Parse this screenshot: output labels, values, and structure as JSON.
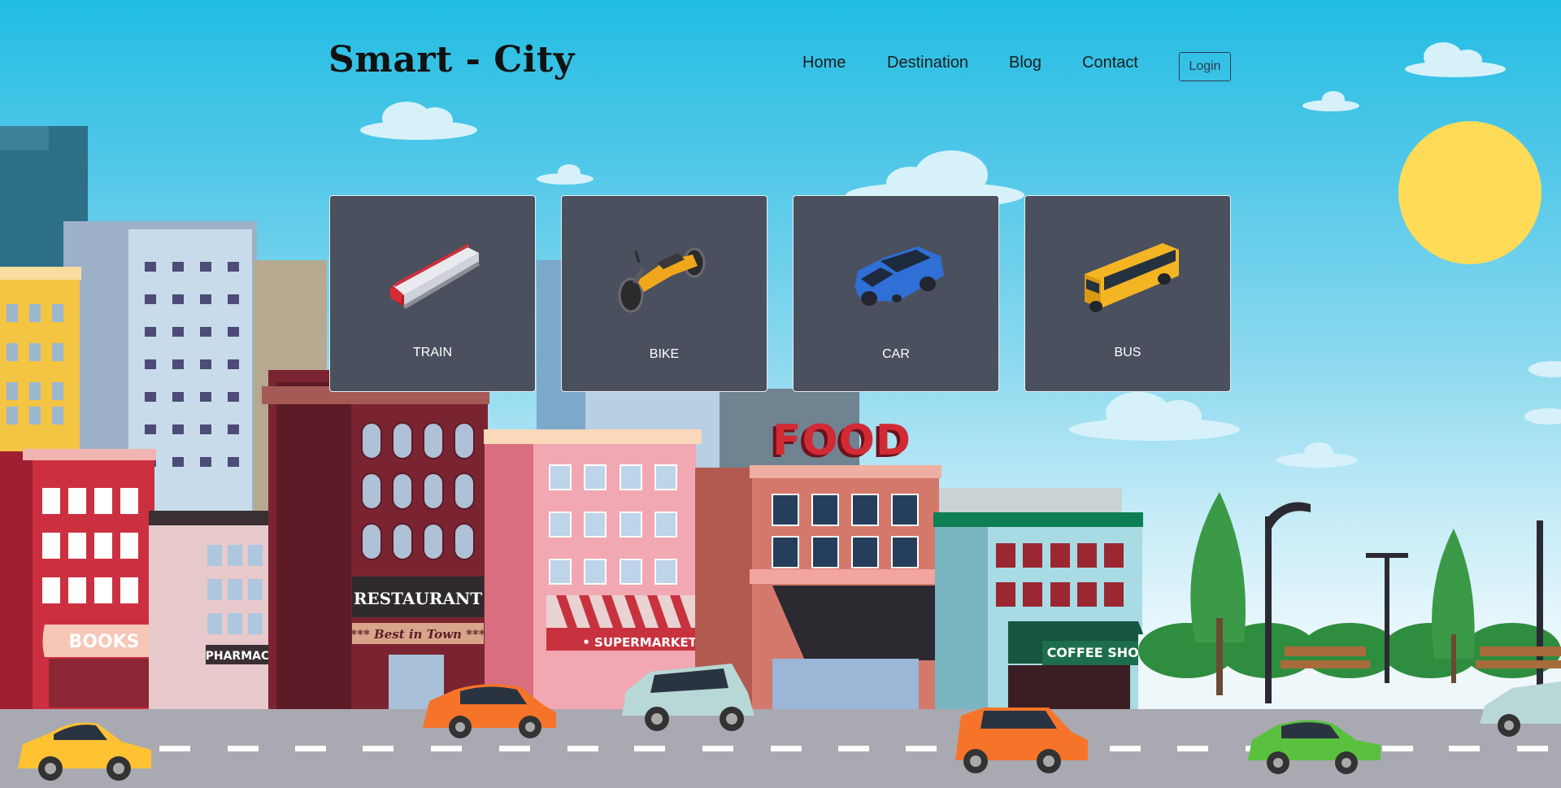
{
  "header": {
    "brand": "Smart - City",
    "nav": [
      "Home",
      "Destination",
      "Blog",
      "Contact"
    ],
    "login_label": "Login"
  },
  "cards": [
    {
      "label": "TRAIN",
      "icon": "train-icon"
    },
    {
      "label": "BIKE",
      "icon": "motorbike-icon"
    },
    {
      "label": "CAR",
      "icon": "car-icon"
    },
    {
      "label": "BUS",
      "icon": "bus-icon"
    }
  ],
  "scene": {
    "signs": {
      "food": "FOOD",
      "books": "BOOKS",
      "pharmacy": "PHARMACY",
      "restaurant": "RESTAURANT",
      "best_in_town": "*** Best in Town ***",
      "supermarket": "• SUPERMARKET •",
      "coffee_shop": "COFFEE SHOP"
    }
  },
  "colors": {
    "sky_top": "#22bde3",
    "card_bg": "#4a505d",
    "sun": "#ffdb57",
    "road": "#a9a9b2"
  }
}
